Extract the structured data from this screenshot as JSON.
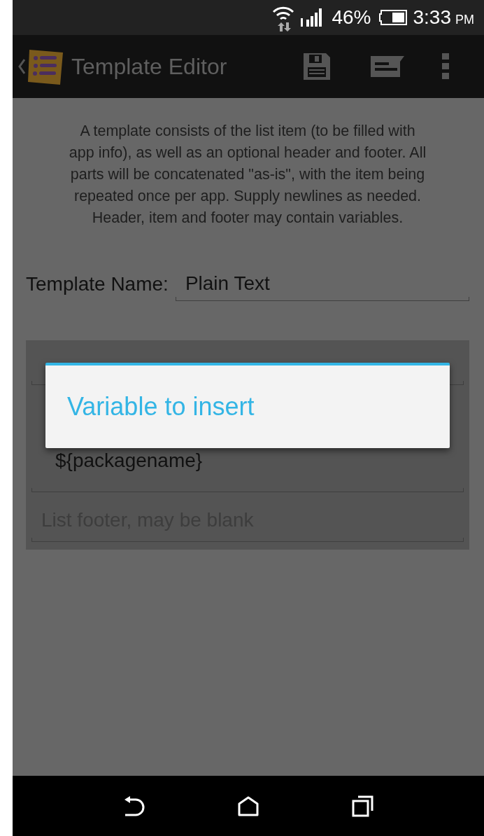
{
  "status_bar": {
    "battery": "46%",
    "time": "3:33",
    "ampm": "PM"
  },
  "action_bar": {
    "title": "Template Editor"
  },
  "description": "A template consists of the list item (to be filled with\napp info), as well as an optional header and footer. All\nparts will be concatenated \"as-is\", with the item being\nrepeated once per app. Supply newlines as needed.\nHeader, item and footer may contain variables.",
  "template_name": {
    "label": "Template Name:",
    "value": "Plain Text"
  },
  "fields": [
    {
      "kind": "empty"
    },
    {
      "kind": "value",
      "value": "${packagename}"
    },
    {
      "kind": "placeholder",
      "placeholder": "List footer, may be blank"
    }
  ],
  "dialog": {
    "title": "Variable to insert"
  }
}
